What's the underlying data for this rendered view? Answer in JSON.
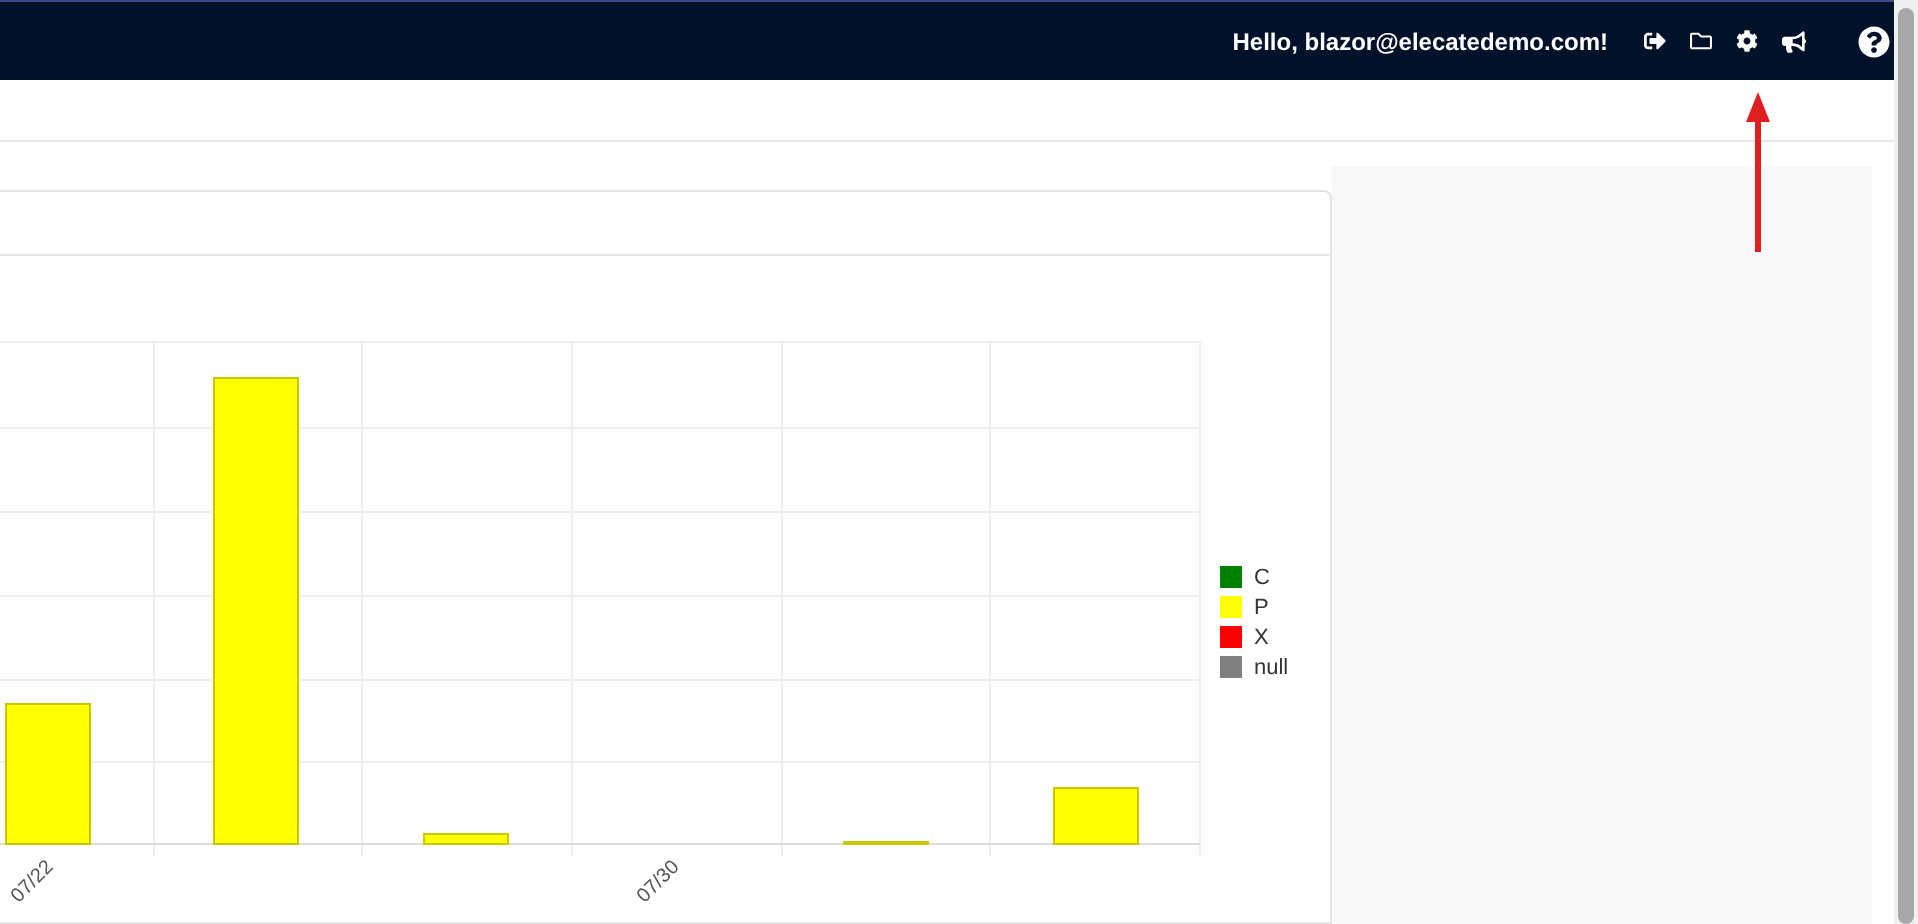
{
  "header": {
    "greeting": "Hello, blazor@elecatedemo.com!"
  },
  "chart": {
    "x_labels": [
      {
        "label": "07/22"
      },
      {
        "label": "07/30"
      }
    ],
    "legend": [
      {
        "label": "C",
        "color": "#008000"
      },
      {
        "label": "P",
        "color": "#ffff00"
      },
      {
        "label": "X",
        "color": "#ff0000"
      },
      {
        "label": "null",
        "color": "#808080"
      }
    ]
  }
}
